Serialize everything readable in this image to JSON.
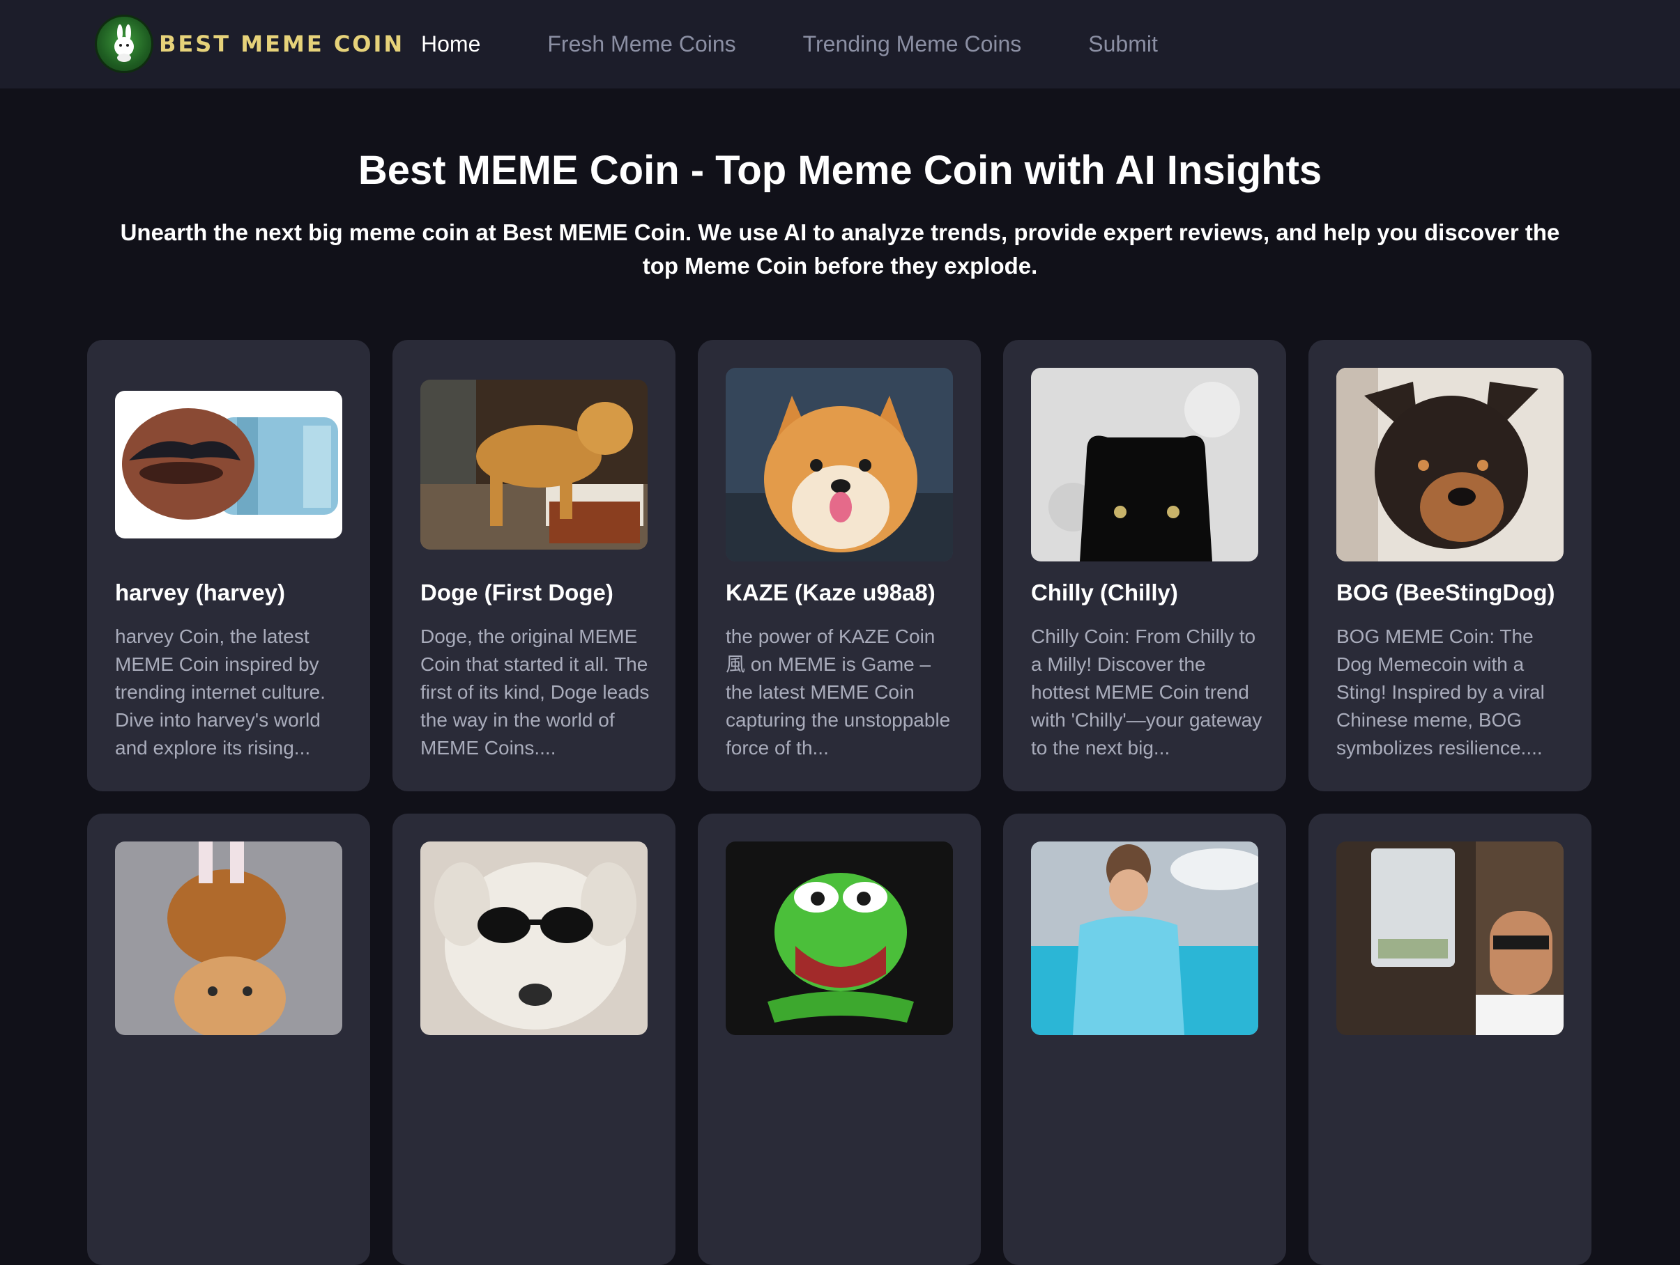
{
  "brand": {
    "logo_icon": "rabbit-logo-icon",
    "name": "Best Meme Coin",
    "colors": {
      "brand_text": "#e6d27a",
      "logo_green": "#2f7d2f"
    }
  },
  "nav": {
    "items": [
      {
        "label": "Home",
        "active": true
      },
      {
        "label": "Fresh Meme Coins",
        "active": false
      },
      {
        "label": "Trending Meme Coins",
        "active": false
      },
      {
        "label": "Submit",
        "active": false
      }
    ]
  },
  "hero": {
    "title": "Best MEME Coin - Top Meme Coin with AI Insights",
    "subtitle": "Unearth the next big meme coin at Best MEME Coin. We use AI to analyze trends, provide expert reviews, and help you discover the top Meme Coin before they explode."
  },
  "colors": {
    "page_bg": "#111119",
    "navbar_bg": "#1c1d2a",
    "card_bg": "#2a2b38",
    "card_text": "#a9acbb",
    "nav_inactive": "#8b8fa3"
  },
  "coins": [
    {
      "image": "mustache-lips-image",
      "title": "harvey (harvey)",
      "description": "harvey Coin, the latest MEME Coin inspired by trending internet culture. Dive into harvey's world and explore its rising..."
    },
    {
      "image": "golden-retriever-image",
      "title": "Doge (First Doge)",
      "description": "Doge, the original MEME Coin that started it all. The first of its kind, Doge leads the way in the world of MEME Coins...."
    },
    {
      "image": "shiba-dog-image",
      "title": "KAZE (Kaze u98a8)",
      "description": "the power of KAZE Coin 風 on MEME is Game – the latest MEME Coin capturing the unstoppable force of th..."
    },
    {
      "image": "black-cat-image",
      "title": "Chilly (Chilly)",
      "description": "Chilly Coin: From Chilly to a Milly! Discover the hottest MEME Coin trend with 'Chilly'—your gateway to the next big..."
    },
    {
      "image": "puppy-image",
      "title": "BOG (BeeStingDog)",
      "description": "BOG MEME Coin: The Dog Memecoin with a Sting! Inspired by a viral Chinese meme, BOG symbolizes resilience...."
    },
    {
      "image": "cat-turkey-hat-image",
      "title": "",
      "description": ""
    },
    {
      "image": "dog-sunglasses-image",
      "title": "",
      "description": ""
    },
    {
      "image": "green-pepe-image",
      "title": "",
      "description": ""
    },
    {
      "image": "boy-blue-car-image",
      "title": "",
      "description": ""
    },
    {
      "image": "man-calculator-image",
      "title": "",
      "description": ""
    }
  ]
}
